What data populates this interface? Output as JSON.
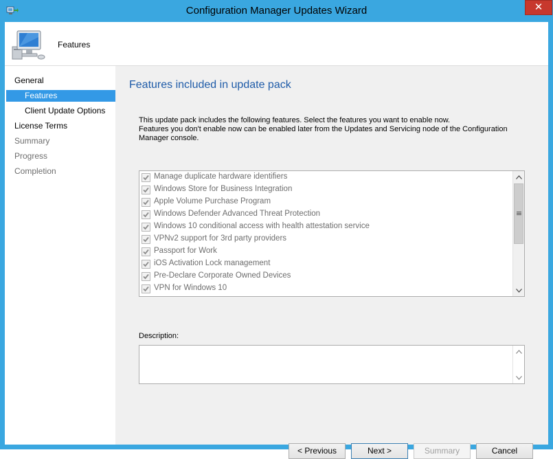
{
  "window": {
    "title": "Configuration Manager Updates Wizard",
    "close_glyph": "✕",
    "icon": "wizard-app-icon",
    "accent_color": "#3aa7e0"
  },
  "header": {
    "title": "Features",
    "icon": "computer-icon"
  },
  "sidebar": {
    "items": [
      {
        "label": "General",
        "state": "normal"
      },
      {
        "label": "Features",
        "state": "selected"
      },
      {
        "label": "Client Update Options",
        "state": "normal"
      },
      {
        "label": "License Terms",
        "state": "normal"
      },
      {
        "label": "Summary",
        "state": "disabled"
      },
      {
        "label": "Progress",
        "state": "disabled"
      },
      {
        "label": "Completion",
        "state": "disabled"
      }
    ],
    "selected_color": "#3399e6"
  },
  "main": {
    "heading": "Features included in update pack",
    "intro_line1": "This update pack includes the following features. Select the features you want to enable now.",
    "intro_line2": "Features you don't enable now can be enabled later from the Updates and Servicing node of the Configuration Manager console.",
    "features": [
      {
        "label": "Manage duplicate hardware identifiers",
        "checked": true,
        "enabled": false
      },
      {
        "label": "Windows Store for Business Integration",
        "checked": true,
        "enabled": false
      },
      {
        "label": "Apple Volume Purchase Program",
        "checked": true,
        "enabled": false
      },
      {
        "label": "Windows Defender Advanced Threat Protection",
        "checked": true,
        "enabled": false
      },
      {
        "label": "Windows 10 conditional access with health attestation service",
        "checked": true,
        "enabled": false
      },
      {
        "label": "VPNv2 support for 3rd party providers",
        "checked": true,
        "enabled": false
      },
      {
        "label": "Passport for Work",
        "checked": true,
        "enabled": false
      },
      {
        "label": "iOS Activation Lock management",
        "checked": true,
        "enabled": false
      },
      {
        "label": "Pre-Declare Corporate Owned Devices",
        "checked": true,
        "enabled": false
      },
      {
        "label": "VPN for Windows 10",
        "checked": true,
        "enabled": false
      }
    ],
    "description_label": "Description:",
    "description_value": ""
  },
  "buttons": {
    "previous": "< Previous",
    "next": "Next >",
    "summary": "Summary",
    "cancel": "Cancel"
  }
}
